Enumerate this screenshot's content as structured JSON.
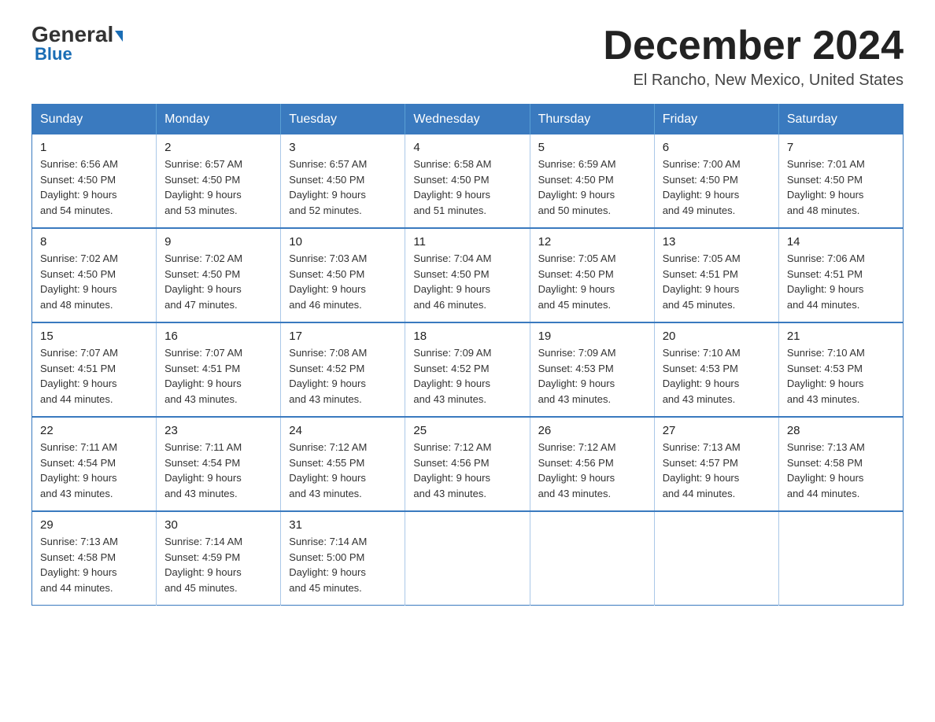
{
  "header": {
    "logo_general": "General",
    "logo_blue": "Blue",
    "main_title": "December 2024",
    "subtitle": "El Rancho, New Mexico, United States"
  },
  "days_of_week": [
    "Sunday",
    "Monday",
    "Tuesday",
    "Wednesday",
    "Thursday",
    "Friday",
    "Saturday"
  ],
  "weeks": [
    [
      {
        "day": "1",
        "sunrise": "6:56 AM",
        "sunset": "4:50 PM",
        "daylight": "9 hours and 54 minutes."
      },
      {
        "day": "2",
        "sunrise": "6:57 AM",
        "sunset": "4:50 PM",
        "daylight": "9 hours and 53 minutes."
      },
      {
        "day": "3",
        "sunrise": "6:57 AM",
        "sunset": "4:50 PM",
        "daylight": "9 hours and 52 minutes."
      },
      {
        "day": "4",
        "sunrise": "6:58 AM",
        "sunset": "4:50 PM",
        "daylight": "9 hours and 51 minutes."
      },
      {
        "day": "5",
        "sunrise": "6:59 AM",
        "sunset": "4:50 PM",
        "daylight": "9 hours and 50 minutes."
      },
      {
        "day": "6",
        "sunrise": "7:00 AM",
        "sunset": "4:50 PM",
        "daylight": "9 hours and 49 minutes."
      },
      {
        "day": "7",
        "sunrise": "7:01 AM",
        "sunset": "4:50 PM",
        "daylight": "9 hours and 48 minutes."
      }
    ],
    [
      {
        "day": "8",
        "sunrise": "7:02 AM",
        "sunset": "4:50 PM",
        "daylight": "9 hours and 48 minutes."
      },
      {
        "day": "9",
        "sunrise": "7:02 AM",
        "sunset": "4:50 PM",
        "daylight": "9 hours and 47 minutes."
      },
      {
        "day": "10",
        "sunrise": "7:03 AM",
        "sunset": "4:50 PM",
        "daylight": "9 hours and 46 minutes."
      },
      {
        "day": "11",
        "sunrise": "7:04 AM",
        "sunset": "4:50 PM",
        "daylight": "9 hours and 46 minutes."
      },
      {
        "day": "12",
        "sunrise": "7:05 AM",
        "sunset": "4:50 PM",
        "daylight": "9 hours and 45 minutes."
      },
      {
        "day": "13",
        "sunrise": "7:05 AM",
        "sunset": "4:51 PM",
        "daylight": "9 hours and 45 minutes."
      },
      {
        "day": "14",
        "sunrise": "7:06 AM",
        "sunset": "4:51 PM",
        "daylight": "9 hours and 44 minutes."
      }
    ],
    [
      {
        "day": "15",
        "sunrise": "7:07 AM",
        "sunset": "4:51 PM",
        "daylight": "9 hours and 44 minutes."
      },
      {
        "day": "16",
        "sunrise": "7:07 AM",
        "sunset": "4:51 PM",
        "daylight": "9 hours and 43 minutes."
      },
      {
        "day": "17",
        "sunrise": "7:08 AM",
        "sunset": "4:52 PM",
        "daylight": "9 hours and 43 minutes."
      },
      {
        "day": "18",
        "sunrise": "7:09 AM",
        "sunset": "4:52 PM",
        "daylight": "9 hours and 43 minutes."
      },
      {
        "day": "19",
        "sunrise": "7:09 AM",
        "sunset": "4:53 PM",
        "daylight": "9 hours and 43 minutes."
      },
      {
        "day": "20",
        "sunrise": "7:10 AM",
        "sunset": "4:53 PM",
        "daylight": "9 hours and 43 minutes."
      },
      {
        "day": "21",
        "sunrise": "7:10 AM",
        "sunset": "4:53 PM",
        "daylight": "9 hours and 43 minutes."
      }
    ],
    [
      {
        "day": "22",
        "sunrise": "7:11 AM",
        "sunset": "4:54 PM",
        "daylight": "9 hours and 43 minutes."
      },
      {
        "day": "23",
        "sunrise": "7:11 AM",
        "sunset": "4:54 PM",
        "daylight": "9 hours and 43 minutes."
      },
      {
        "day": "24",
        "sunrise": "7:12 AM",
        "sunset": "4:55 PM",
        "daylight": "9 hours and 43 minutes."
      },
      {
        "day": "25",
        "sunrise": "7:12 AM",
        "sunset": "4:56 PM",
        "daylight": "9 hours and 43 minutes."
      },
      {
        "day": "26",
        "sunrise": "7:12 AM",
        "sunset": "4:56 PM",
        "daylight": "9 hours and 43 minutes."
      },
      {
        "day": "27",
        "sunrise": "7:13 AM",
        "sunset": "4:57 PM",
        "daylight": "9 hours and 44 minutes."
      },
      {
        "day": "28",
        "sunrise": "7:13 AM",
        "sunset": "4:58 PM",
        "daylight": "9 hours and 44 minutes."
      }
    ],
    [
      {
        "day": "29",
        "sunrise": "7:13 AM",
        "sunset": "4:58 PM",
        "daylight": "9 hours and 44 minutes."
      },
      {
        "day": "30",
        "sunrise": "7:14 AM",
        "sunset": "4:59 PM",
        "daylight": "9 hours and 45 minutes."
      },
      {
        "day": "31",
        "sunrise": "7:14 AM",
        "sunset": "5:00 PM",
        "daylight": "9 hours and 45 minutes."
      },
      null,
      null,
      null,
      null
    ]
  ],
  "labels": {
    "sunrise": "Sunrise:",
    "sunset": "Sunset:",
    "daylight": "Daylight:"
  }
}
